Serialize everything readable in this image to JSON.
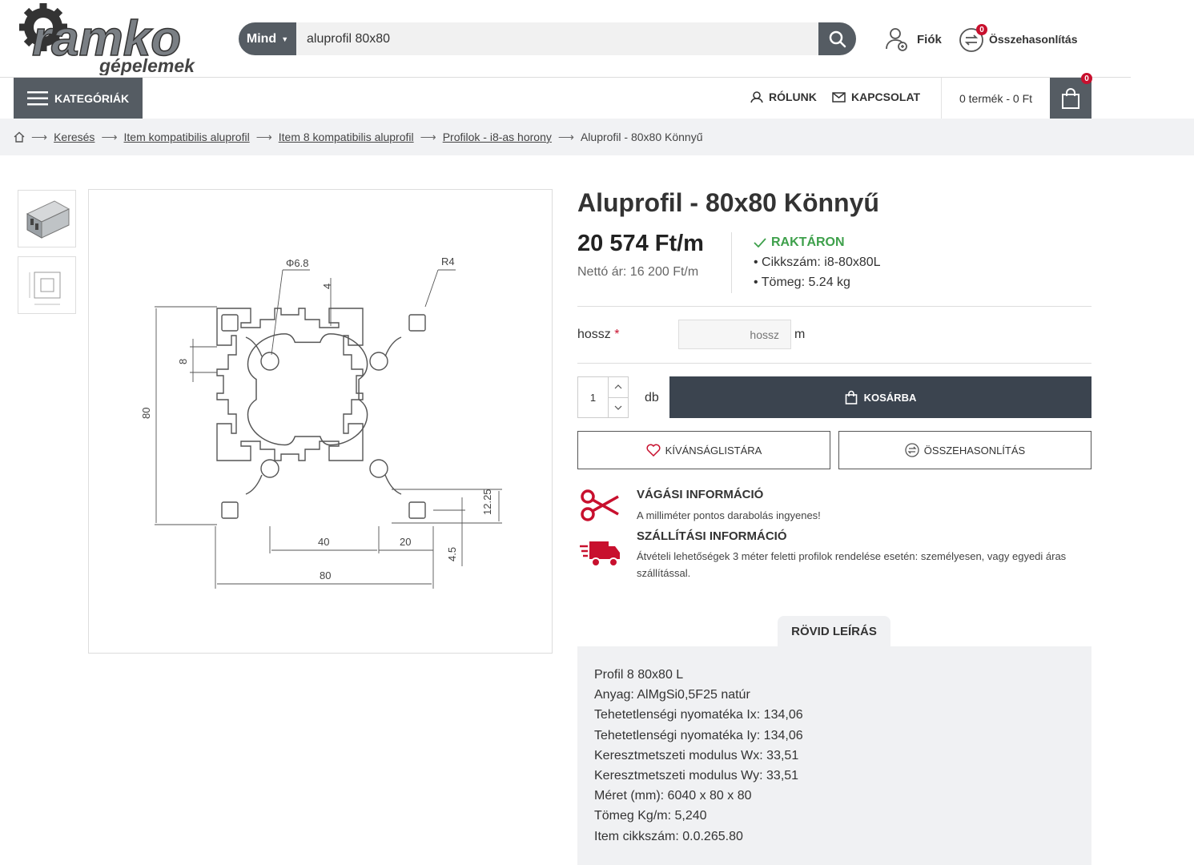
{
  "header": {
    "logo_text": "ramko",
    "logo_sub": "gépelemek",
    "search_category": "Mind",
    "search_value": "aluprofil 80x80",
    "account_label": "Fiók",
    "compare_label": "Összehasonlítás",
    "compare_count": "0"
  },
  "nav": {
    "categories_label": "KATEGÓRIÁK",
    "about_label": "RÓLUNK",
    "contact_label": "KAPCSOLAT",
    "cart_summary": "0 termék - 0 Ft",
    "cart_count": "0"
  },
  "breadcrumb": {
    "items": [
      "Keresés",
      "Item kompatibilis aluprofil",
      "Item 8 kompatibilis aluprofil",
      "Profilok - i8-as horony"
    ],
    "current": "Aluprofil - 80x80 Könnyű"
  },
  "drawing": {
    "dims": [
      "Φ6.8",
      "R4",
      "4",
      "8",
      "80",
      "12.25",
      "40",
      "20",
      "4.5",
      "80"
    ]
  },
  "product": {
    "title": "Aluprofil - 80x80 Könnyű",
    "price": "20 574 Ft/m",
    "netto": "Nettó ár: 16 200 Ft/m",
    "stock": "RAKTÁRON",
    "sku": "Cikkszám: i8-80x80L",
    "weight": "Tömeg: 5.24 kg",
    "length_label": "hossz",
    "length_required": "*",
    "length_placeholder": "hossz",
    "length_unit": "m",
    "qty": "1",
    "qty_unit": "db",
    "add_to_cart": "KOSÁRBA",
    "wishlist": "KÍVÁNSÁGLISTÁRA",
    "compare": "ÖSSZEHASONLÍTÁS"
  },
  "info": {
    "cut_title": "VÁGÁSI INFORMÁCIÓ",
    "cut_text": "A milliméter pontos darabolás ingyenes!",
    "ship_title": "SZÁLLÍTÁSI INFORMÁCIÓ",
    "ship_text": "Átvételi lehetőségek 3 méter feletti profilok rendelése esetén: személyesen, vagy egyedi áras szállítással."
  },
  "description": {
    "tab": "RÖVID LEÍRÁS",
    "lines": [
      "Profil 8 80x80 L",
      "Anyag: AlMgSi0,5F25 natúr",
      "Tehetetlenségi nyomatéka Ix: 134,06",
      "Tehetetlenségi nyomatéka Iy: 134,06",
      "Keresztmetszeti modulus Wx: 33,51",
      "Keresztmetszeti modulus Wy: 33,51",
      "Méret (mm): 6040 x 80 x 80",
      "Tömeg Kg/m: 5,240",
      "Item cikkszám: 0.0.265.80"
    ]
  },
  "colors": {
    "accent_dark": "#555c63",
    "button_dark": "#3b444f",
    "stock_green": "#3ea04b",
    "red": "#c8102e"
  }
}
